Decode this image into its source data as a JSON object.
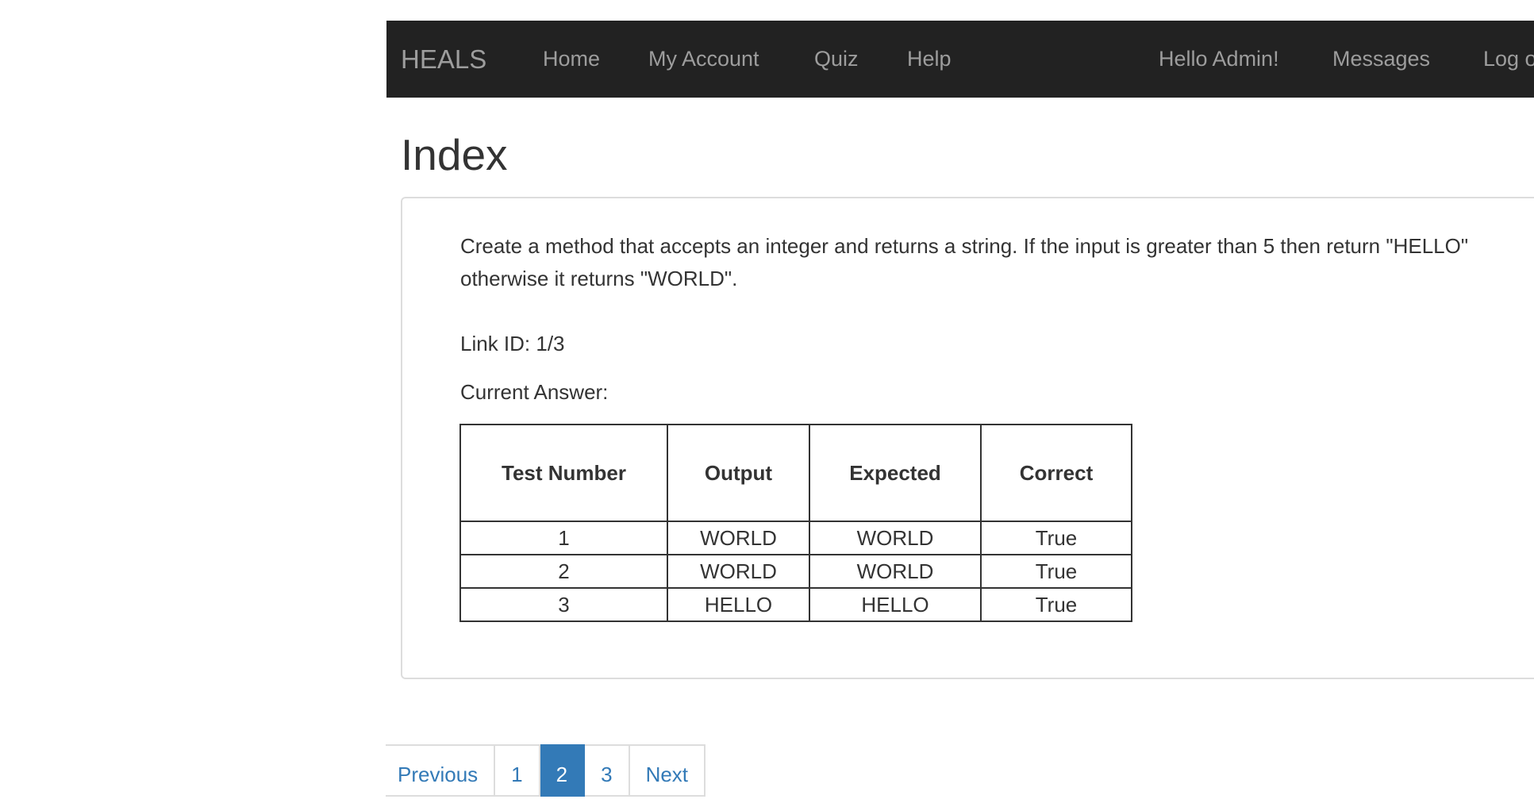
{
  "navbar": {
    "brand": "HEALS",
    "links": [
      "Home",
      "My Account",
      "Quiz",
      "Help"
    ],
    "right_links": [
      "Hello Admin!",
      "Messages",
      "Log out"
    ]
  },
  "page": {
    "title": "Index"
  },
  "question": {
    "text": "Create a method that accepts an integer and returns a string. If the input is greater than 5 then return \"HELLO\" otherwise it returns \"WORLD\".",
    "link_id": "Link ID: 1/3",
    "current_answer_label": "Current Answer:"
  },
  "results_table": {
    "headers": [
      "Test Number",
      "Output",
      "Expected",
      "Correct"
    ],
    "rows": [
      [
        "1",
        "WORLD",
        "WORLD",
        "True"
      ],
      [
        "2",
        "WORLD",
        "WORLD",
        "True"
      ],
      [
        "3",
        "HELLO",
        "HELLO",
        "True"
      ]
    ]
  },
  "pagination": {
    "previous": "Previous",
    "pages": [
      "1",
      "2",
      "3"
    ],
    "active_page": "2",
    "next": "Next"
  },
  "colors": {
    "navbar_bg": "#222222",
    "nav_text": "#9d9d9d",
    "link": "#337ab7",
    "active_page_bg": "#337ab7"
  }
}
